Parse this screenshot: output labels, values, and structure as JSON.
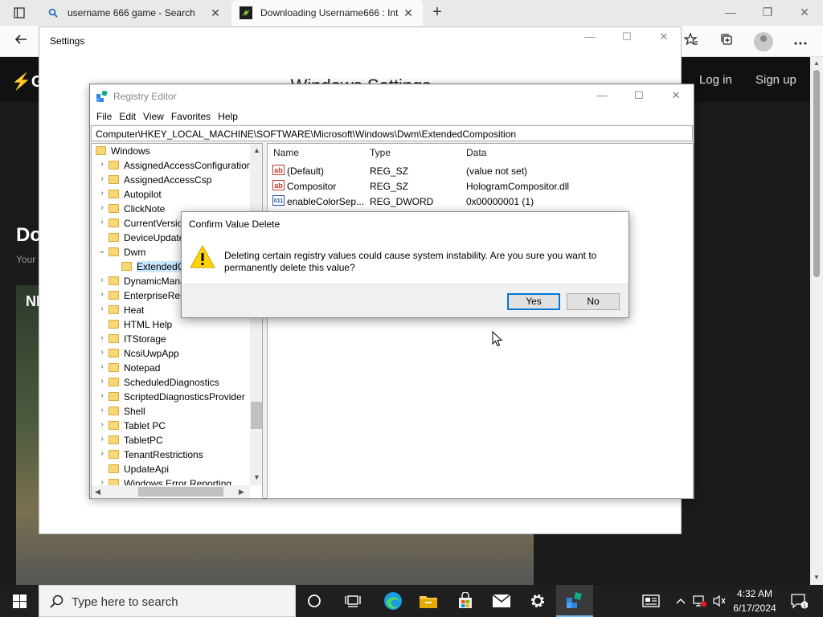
{
  "browser": {
    "tabs": [
      {
        "title": "username 666 game - Search",
        "icon": "search-icon"
      },
      {
        "title": "Downloading Username666 : Int",
        "icon": "site-logo-icon"
      }
    ],
    "window_controls": {
      "minimize": "—",
      "restore": "❐",
      "close": "✕"
    }
  },
  "website": {
    "logo": "⚡G",
    "login": "Log in",
    "signup": "Sign up",
    "heading": "Do",
    "subtitle": "Your",
    "video_label": "NI"
  },
  "settings": {
    "title": "Settings",
    "heading": "Windows Settings"
  },
  "regedit": {
    "title": "Registry Editor",
    "menu": [
      "File",
      "Edit",
      "View",
      "Favorites",
      "Help"
    ],
    "path": "Computer\\HKEY_LOCAL_MACHINE\\SOFTWARE\\Microsoft\\Windows\\Dwm\\ExtendedComposition",
    "tree": [
      {
        "label": "Windows",
        "level": 0,
        "state": "none"
      },
      {
        "label": "AssignedAccessConfiguration",
        "level": 1,
        "state": "collapsed"
      },
      {
        "label": "AssignedAccessCsp",
        "level": 1,
        "state": "collapsed"
      },
      {
        "label": "Autopilot",
        "level": 1,
        "state": "collapsed"
      },
      {
        "label": "ClickNote",
        "level": 1,
        "state": "collapsed"
      },
      {
        "label": "CurrentVersion",
        "level": 1,
        "state": "collapsed"
      },
      {
        "label": "DeviceUpdate",
        "level": 1,
        "state": "none"
      },
      {
        "label": "Dwm",
        "level": 1,
        "state": "expanded"
      },
      {
        "label": "ExtendedComposition",
        "level": 2,
        "state": "selected"
      },
      {
        "label": "DynamicManagement",
        "level": 1,
        "state": "collapsed"
      },
      {
        "label": "EnterpriseResourceManager",
        "level": 1,
        "state": "collapsed"
      },
      {
        "label": "Heat",
        "level": 1,
        "state": "collapsed"
      },
      {
        "label": "HTML Help",
        "level": 1,
        "state": "none"
      },
      {
        "label": "ITStorage",
        "level": 1,
        "state": "collapsed"
      },
      {
        "label": "NcsiUwpApp",
        "level": 1,
        "state": "collapsed"
      },
      {
        "label": "Notepad",
        "level": 1,
        "state": "collapsed"
      },
      {
        "label": "ScheduledDiagnostics",
        "level": 1,
        "state": "collapsed"
      },
      {
        "label": "ScriptedDiagnosticsProvider",
        "level": 1,
        "state": "collapsed"
      },
      {
        "label": "Shell",
        "level": 1,
        "state": "collapsed"
      },
      {
        "label": "Tablet PC",
        "level": 1,
        "state": "collapsed"
      },
      {
        "label": "TabletPC",
        "level": 1,
        "state": "collapsed"
      },
      {
        "label": "TenantRestrictions",
        "level": 1,
        "state": "collapsed"
      },
      {
        "label": "UpdateApi",
        "level": 1,
        "state": "none"
      },
      {
        "label": "Windows Error Reporting",
        "level": 1,
        "state": "collapsed"
      }
    ],
    "columns": {
      "name": "Name",
      "type": "Type",
      "data": "Data"
    },
    "values": [
      {
        "name": "(Default)",
        "type": "REG_SZ",
        "data": "(value not set)",
        "icon": "ab"
      },
      {
        "name": "Compositor",
        "type": "REG_SZ",
        "data": "HologramCompositor.dll",
        "icon": "ab"
      },
      {
        "name": "enableColorSep...",
        "type": "REG_DWORD",
        "data": "0x00000001 (1)",
        "icon": "011"
      }
    ]
  },
  "dialog": {
    "title": "Confirm Value Delete",
    "message": "Deleting certain registry values could cause system instability. Are you sure you want to permanently delete this value?",
    "yes": "Yes",
    "no": "No"
  },
  "taskbar": {
    "search_placeholder": "Type here to search",
    "time": "4:32 AM",
    "date": "6/17/2024",
    "notification_count": "1"
  }
}
